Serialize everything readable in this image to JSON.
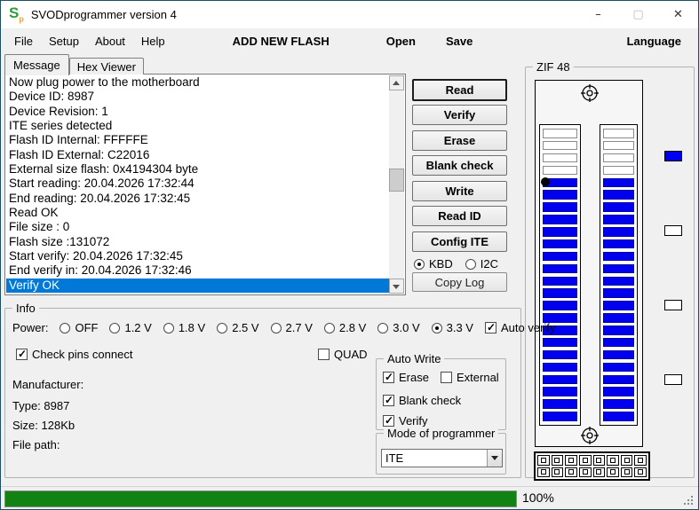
{
  "window": {
    "title": "SVODprogrammer version 4",
    "icon": "S",
    "icon_sub": "p",
    "controls": {
      "minimize": "–",
      "maximize": "▢",
      "close": "✕"
    }
  },
  "menu": {
    "items": [
      "File",
      "Setup",
      "About",
      "Help"
    ],
    "add_new_flash": "ADD NEW FLASH",
    "open": "Open",
    "save": "Save",
    "language": "Language"
  },
  "tabs": [
    {
      "label": "Message",
      "active": true
    },
    {
      "label": "Hex Viewer",
      "active": false
    }
  ],
  "log": {
    "lines": [
      "Now plug power to the motherboard",
      "Device ID: 8987",
      "Device Revision: 1",
      "ITE series detected",
      "Flash ID Internal: FFFFFE",
      "Flash ID External: C22016",
      "External size flash: 0x4194304 byte",
      "Start reading: 20.04.2026 17:32:44",
      "End reading: 20.04.2026 17:32:45",
      "Read OK",
      "File size : 0",
      "Flash size :131072",
      "Start verify: 20.04.2026 17:32:45",
      "End verify in: 20.04.2026 17:32:46",
      "Verify OK"
    ],
    "selected_index": 14,
    "selected_line": "Verify OK"
  },
  "actions": {
    "buttons": [
      "Read",
      "Verify",
      "Erase",
      "Blank check",
      "Write",
      "Read ID",
      "Config ITE"
    ],
    "default_button": "Read",
    "interface_radios": [
      {
        "label": "KBD",
        "selected": true
      },
      {
        "label": "I2C",
        "selected": false
      }
    ],
    "kbd_selected": true,
    "i2c_selected": false,
    "copy_log": "Copy Log"
  },
  "zif": {
    "label": "ZIF 48",
    "pins_per_column": 24,
    "empty_top_rows": 4,
    "marked_pin_row": 5,
    "connector_rows": 2,
    "connector_cols": 8,
    "indicators": [
      "on",
      "off",
      "off",
      "off"
    ]
  },
  "info": {
    "label": "Info",
    "power_label": "Power:",
    "power_options": [
      {
        "label": "OFF",
        "selected": false
      },
      {
        "label": "1.2 V",
        "selected": false
      },
      {
        "label": "1.8 V",
        "selected": false
      },
      {
        "label": "2.5 V",
        "selected": false
      },
      {
        "label": "2.7 V",
        "selected": false
      },
      {
        "label": "2.8 V",
        "selected": false
      },
      {
        "label": "3.0 V",
        "selected": false
      },
      {
        "label": "3.3 V",
        "selected": true
      }
    ],
    "auto_verify": {
      "label": "Auto verify",
      "checked": true
    },
    "check_pins": {
      "label": "Check pins connect",
      "checked": true
    },
    "quad": {
      "label": "QUAD",
      "checked": false
    },
    "manufacturer": "Manufacturer:",
    "type": "Type: 8987",
    "size": "Size: 128Kb",
    "file_path": "File path:"
  },
  "auto_write": {
    "label": "Auto Write",
    "erase": {
      "label": "Erase",
      "checked": true
    },
    "external": {
      "label": "External",
      "checked": false
    },
    "blank_check": {
      "label": "Blank check",
      "checked": true
    },
    "verify": {
      "label": "Verify",
      "checked": true
    }
  },
  "mode": {
    "label": "Mode of programmer",
    "value": "ITE"
  },
  "status": {
    "progress_percent": 100,
    "progress_label": "100%"
  },
  "colors": {
    "ui_bg": "#f0f0f0",
    "titlebar_bg": "#ffffff",
    "pin_blue": "#0000ee",
    "progress_green": "#128312",
    "selection_blue": "#0078d7",
    "accent_border": "#1a4f66"
  }
}
